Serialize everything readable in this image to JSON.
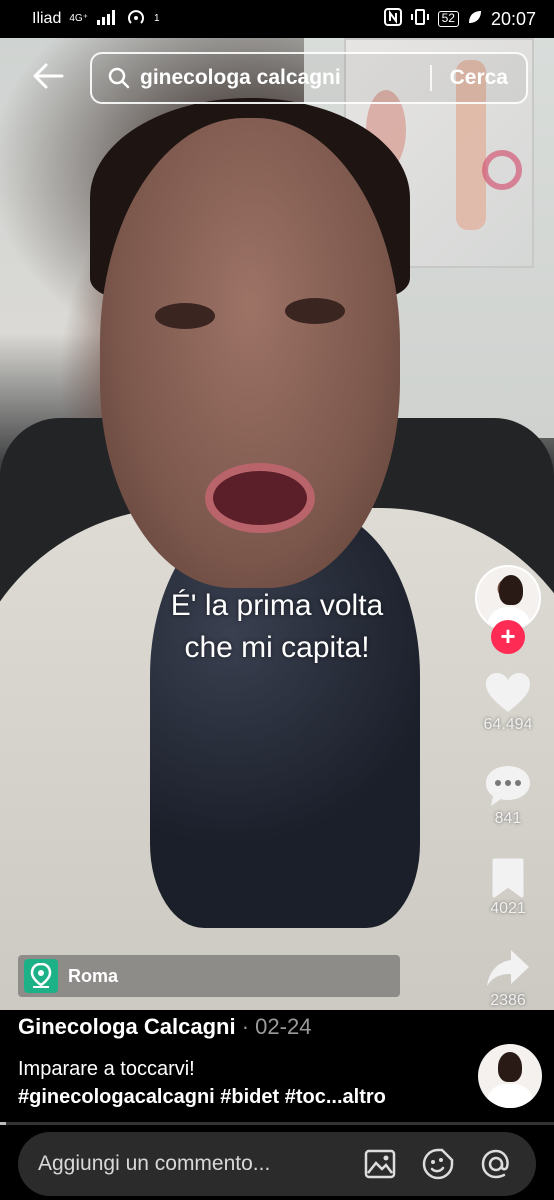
{
  "status_bar": {
    "carrier": "Iliad",
    "network": "4G⁺",
    "hotspot_badge": "1",
    "battery": "52",
    "time": "20:07"
  },
  "search": {
    "query": "ginecologa calcagni",
    "submit_label": "Cerca"
  },
  "video": {
    "caption_line1": "É' la prima volta",
    "caption_line2": "che mi capita!",
    "progress": 0.01
  },
  "actions": {
    "likes": "64.494",
    "comments": "841",
    "saves": "4021",
    "shares": "2386",
    "follow_symbol": "+"
  },
  "location": {
    "label": "Roma"
  },
  "post": {
    "author": "Ginecologa Calcagni",
    "date": " · 02-24",
    "description": "Imparare a toccarvi!",
    "hashtags": "#ginecologacalcagni #bidet #toc",
    "more": "...altro"
  },
  "comment": {
    "placeholder": "Aggiungi un commento..."
  },
  "icons": {
    "back": "arrow-left",
    "search": "magnifier",
    "like": "heart",
    "comment": "speech-bubble",
    "save": "bookmark",
    "share": "share-arrow",
    "location": "map-pin",
    "image": "image",
    "emoji": "sticker-smile",
    "mention": "at-sign"
  },
  "colors": {
    "accent": "#fe2c55",
    "location_green": "#1db187"
  }
}
